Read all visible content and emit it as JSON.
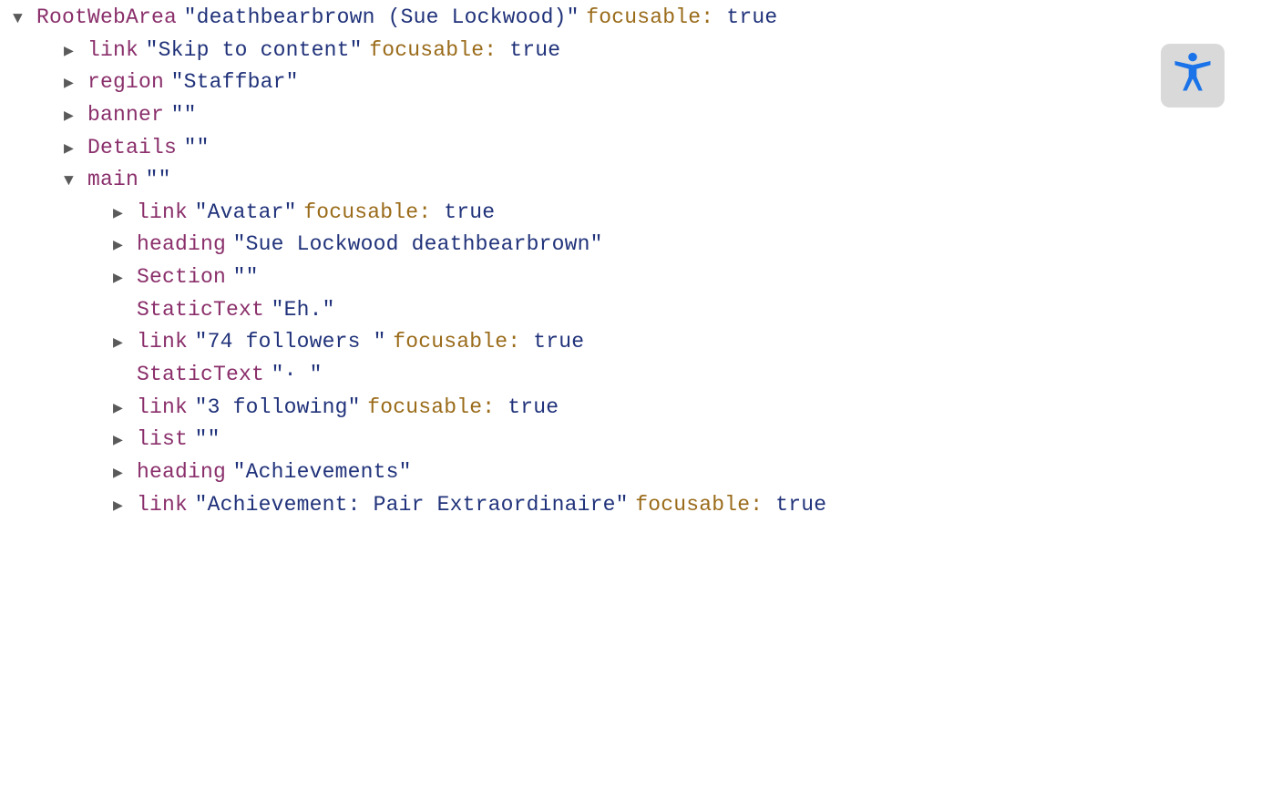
{
  "focusable_label": "focusable",
  "focusable_value": "true",
  "tree": {
    "root": {
      "role": "RootWebArea",
      "name": "\"deathbearbrown (Sue Lockwood)\""
    },
    "level2": [
      {
        "role": "link",
        "name": "\"Skip to content\"",
        "focusable": true,
        "arrow": "right"
      },
      {
        "role": "region",
        "name": "\"Staffbar\"",
        "focusable": false,
        "arrow": "right"
      },
      {
        "role": "banner",
        "name": "\"\"",
        "focusable": false,
        "arrow": "right"
      },
      {
        "role": "Details",
        "name": "\"\"",
        "focusable": false,
        "arrow": "right"
      },
      {
        "role": "main",
        "name": "\"\"",
        "focusable": false,
        "arrow": "down"
      }
    ],
    "level3": [
      {
        "role": "link",
        "name": "\"Avatar\"",
        "focusable": true,
        "arrow": "right"
      },
      {
        "role": "heading",
        "name": "\"Sue Lockwood deathbearbrown\"",
        "focusable": false,
        "arrow": "right"
      },
      {
        "role": "Section",
        "name": "\"\"",
        "focusable": false,
        "arrow": "right"
      },
      {
        "role": "StaticText",
        "name": "\"Eh.\"",
        "focusable": false,
        "arrow": "none"
      },
      {
        "role": "link",
        "name": "\"74 followers \"",
        "focusable": true,
        "arrow": "right"
      },
      {
        "role": "StaticText",
        "name": "\"· \"",
        "focusable": false,
        "arrow": "none"
      },
      {
        "role": "link",
        "name": "\"3 following\"",
        "focusable": true,
        "arrow": "right"
      },
      {
        "role": "list",
        "name": "\"\"",
        "focusable": false,
        "arrow": "right"
      },
      {
        "role": "heading",
        "name": "\"Achievements\"",
        "focusable": false,
        "arrow": "right"
      },
      {
        "role": "link",
        "name": "\"Achievement: Pair Extraordinaire\"",
        "focusable": true,
        "arrow": "right"
      }
    ]
  }
}
